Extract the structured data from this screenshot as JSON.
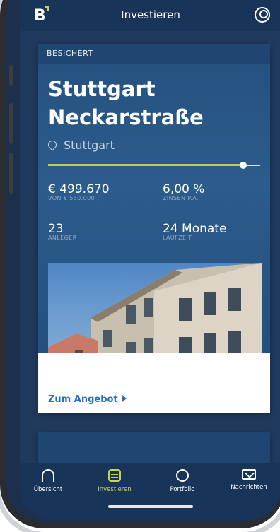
{
  "app": {
    "logo": "B",
    "title": "Investieren"
  },
  "offer": {
    "badge": "BESICHERT",
    "title_line1": "Stuttgart",
    "title_line2": "Neckarstraße",
    "location": "Stuttgart",
    "funding_progress": 0.92,
    "amount": "€ 499.670",
    "amount_label": "VON € 550.000",
    "interest": "6,00 %",
    "interest_label": "ZINSEN P.A.",
    "investors": "23",
    "investors_label": "ANLEGER",
    "term": "24 Monate",
    "term_label": "LAUFZEIT",
    "cta": "Zum Angebot"
  },
  "nav": {
    "items": [
      {
        "label": "Übersicht",
        "icon": "home-icon"
      },
      {
        "label": "Investieren",
        "icon": "coins-icon"
      },
      {
        "label": "Portfolio",
        "icon": "portfolio-icon"
      },
      {
        "label": "Nachrichten",
        "icon": "mail-icon"
      }
    ],
    "active_index": 1
  },
  "colors": {
    "accent": "#c9d646",
    "navy": "#183559",
    "link": "#2a6ec3"
  }
}
